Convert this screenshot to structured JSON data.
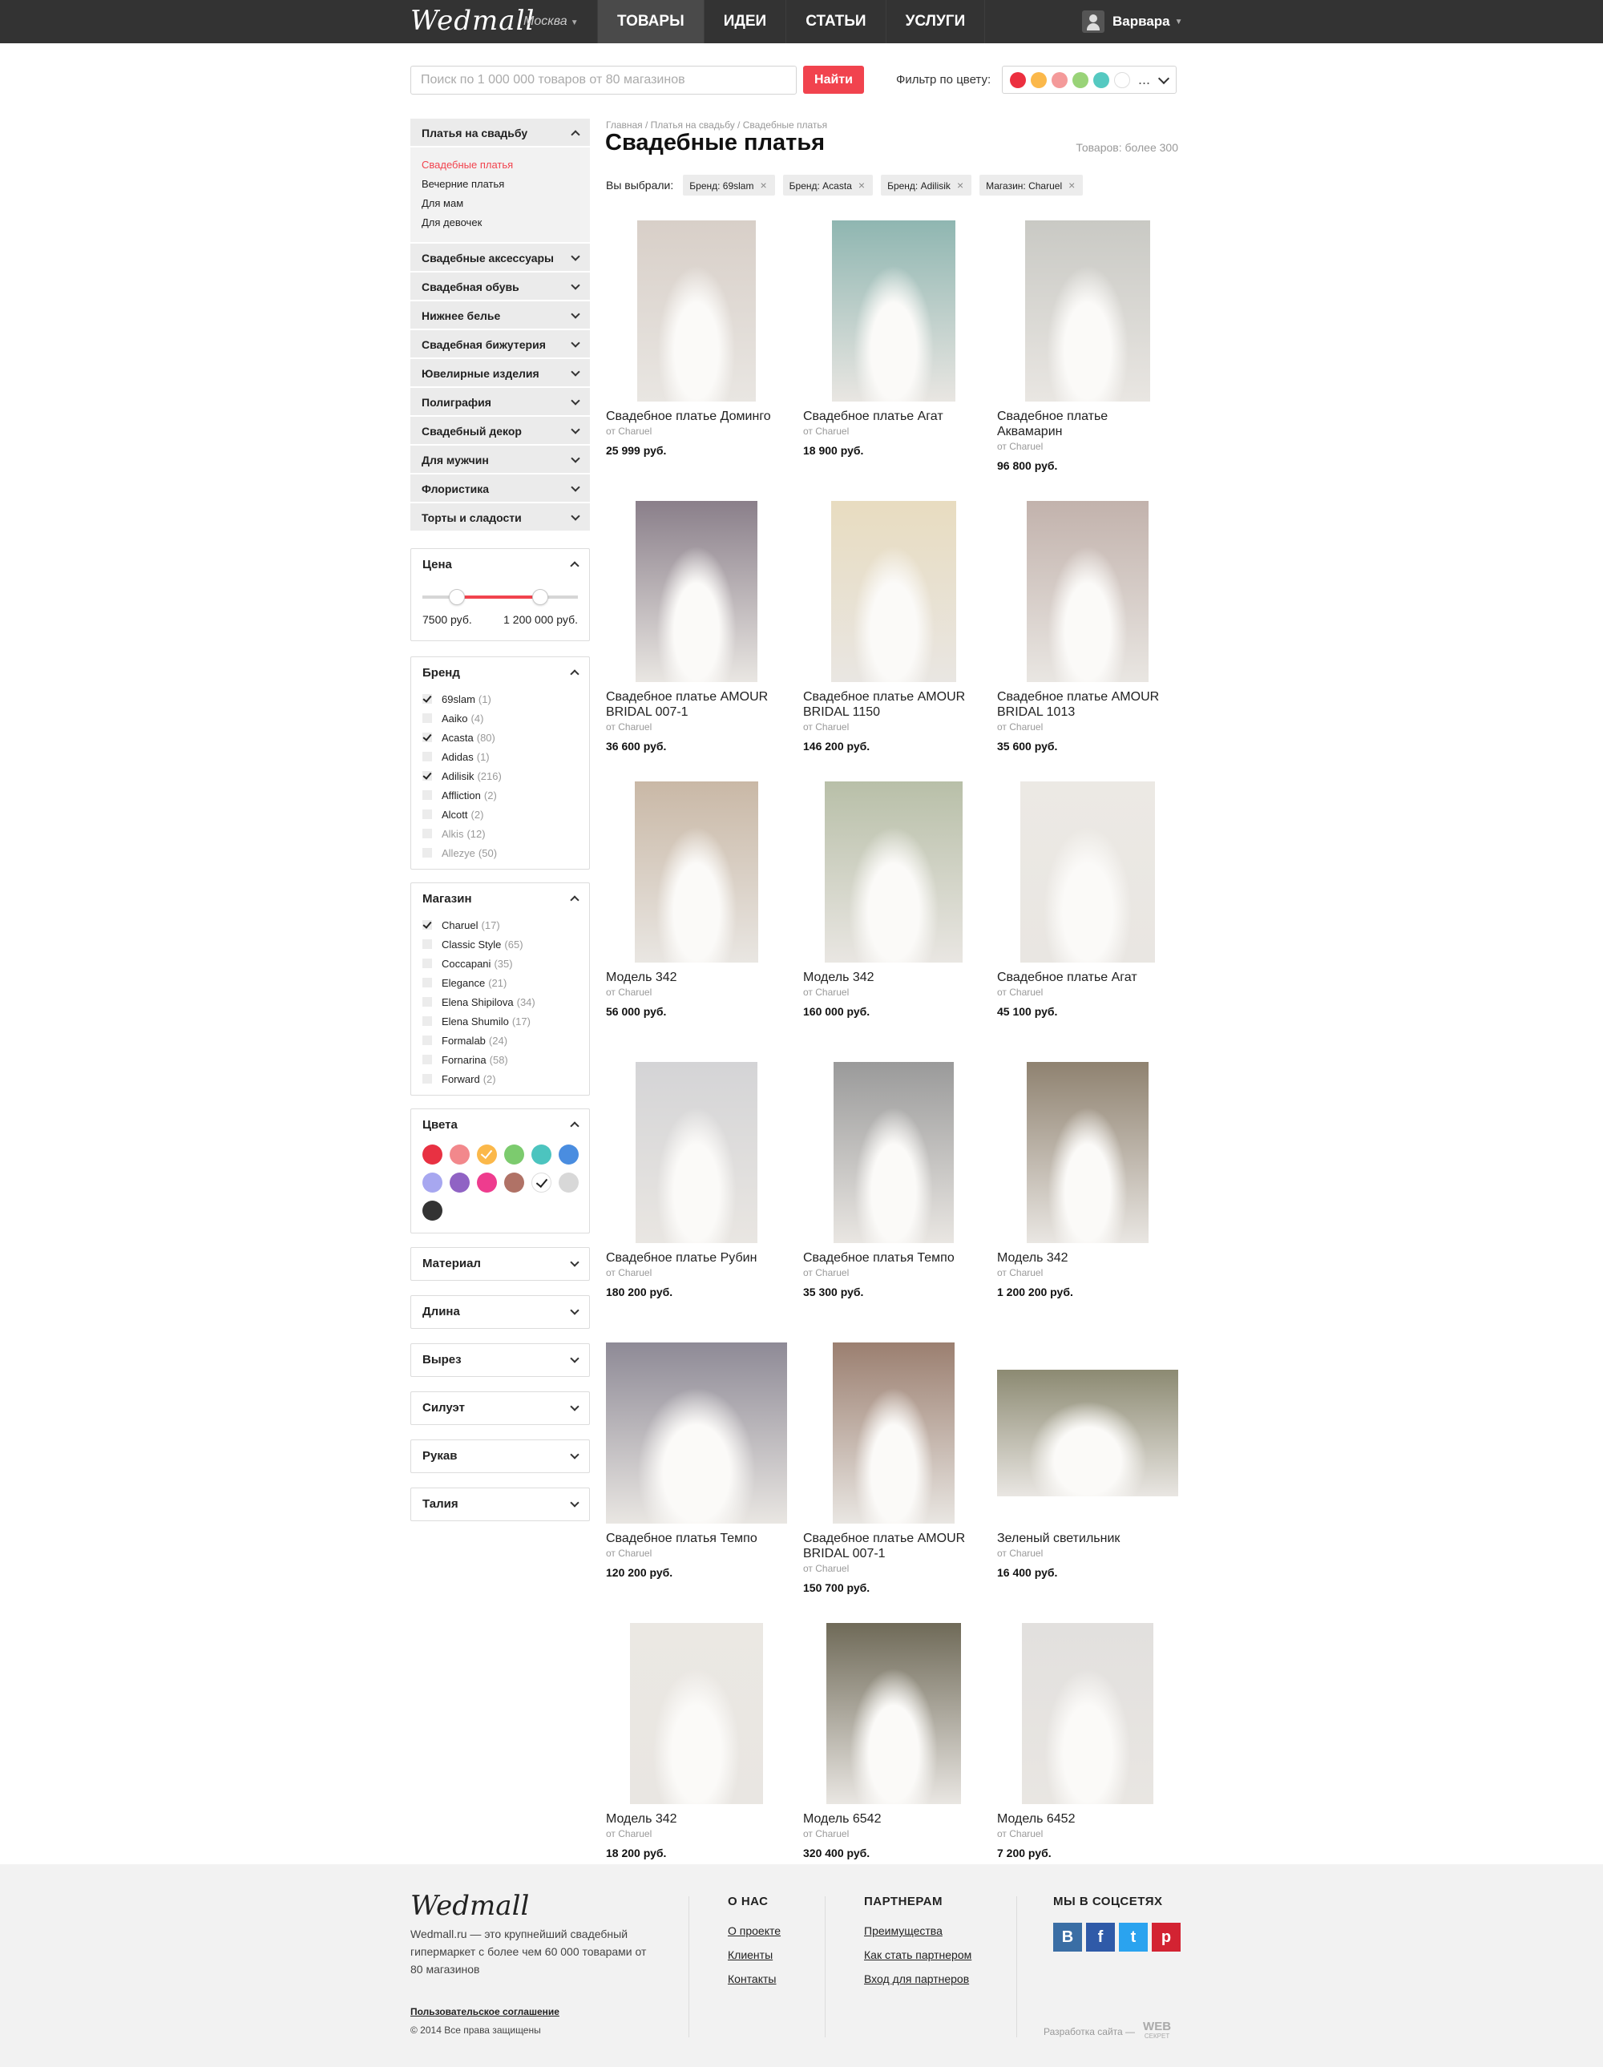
{
  "header": {
    "logo": "Wedmall",
    "city": "Москва",
    "nav": [
      "ТОВАРЫ",
      "ИДЕИ",
      "СТАТЬИ",
      "УСЛУГИ"
    ],
    "user": "Варвара"
  },
  "search": {
    "placeholder": "Поиск по 1 000 000 товаров от 80 магазинов",
    "button": "Найти",
    "color_filter_label": "Фильтр по цвету:",
    "color_filter_dots": [
      "#ec2f3f",
      "#fbb84a",
      "#f49a9a",
      "#99d378",
      "#55c9c1",
      "#ffffff"
    ],
    "more": "..."
  },
  "sidebar": {
    "open_category": "Платья на свадьбу",
    "subcategories": [
      "Свадебные платья",
      "Вечерние платья",
      "Для мам",
      "Для девочек"
    ],
    "categories": [
      "Свадебные аксессуары",
      "Свадебная обувь",
      "Нижнее белье",
      "Свадебная бижутерия",
      "Ювелирные изделия",
      "Полиграфия",
      "Свадебный декор",
      "Для мужчин",
      "Флористика",
      "Торты и сладости"
    ],
    "price": {
      "title": "Цена",
      "min": "7500 руб.",
      "max": "1 200 000 руб.",
      "range_low": 0.22,
      "range_high": 0.75
    },
    "brand": {
      "title": "Бренд",
      "items": [
        {
          "name": "69slam",
          "count": "(1)",
          "checked": true
        },
        {
          "name": "Aaiko",
          "count": "(4)",
          "checked": false
        },
        {
          "name": "Acasta",
          "count": "(80)",
          "checked": true
        },
        {
          "name": "Adidas",
          "count": "(1)",
          "checked": false
        },
        {
          "name": "Adilisik",
          "count": "(216)",
          "checked": true
        },
        {
          "name": "Affliction",
          "count": "(2)",
          "checked": false
        },
        {
          "name": "Alcott",
          "count": "(2)",
          "checked": false
        },
        {
          "name": "Alkis",
          "count": "(12)",
          "checked": false
        },
        {
          "name": "Allezye",
          "count": "(50)",
          "checked": false
        }
      ]
    },
    "shop": {
      "title": "Магазин",
      "items": [
        {
          "name": "Charuel",
          "count": "(17)",
          "checked": true
        },
        {
          "name": "Classic Style",
          "count": "(65)",
          "checked": false
        },
        {
          "name": "Coccapani",
          "count": "(35)",
          "checked": false
        },
        {
          "name": "Elegance",
          "count": "(21)",
          "checked": false
        },
        {
          "name": "Elena Shipilova",
          "count": "(34)",
          "checked": false
        },
        {
          "name": "Elena Shumilo",
          "count": "(17)",
          "checked": false
        },
        {
          "name": "Formalab",
          "count": "(24)",
          "checked": false
        },
        {
          "name": "Fornarina",
          "count": "(58)",
          "checked": false
        },
        {
          "name": "Forward",
          "count": "(2)",
          "checked": false
        }
      ]
    },
    "colors": {
      "title": "Цвета",
      "swatches": [
        {
          "color": "#e83142",
          "checked": false
        },
        {
          "color": "#f2888c",
          "checked": false
        },
        {
          "color": "#fbb84a",
          "checked": true
        },
        {
          "color": "#7ccb6e",
          "checked": false
        },
        {
          "color": "#4cc4bf",
          "checked": false
        },
        {
          "color": "#4a8de0",
          "checked": false
        },
        {
          "color": "#a7a7f0",
          "checked": false
        },
        {
          "color": "#9063c4",
          "checked": false
        },
        {
          "color": "#ee3c8e",
          "checked": false
        },
        {
          "color": "#b07266",
          "checked": false
        },
        {
          "color": "#ffffff",
          "checked": true
        },
        {
          "color": "#d8d8d8",
          "checked": false
        },
        {
          "color": "#333333",
          "checked": false
        }
      ]
    },
    "collapsed_filters": [
      "Материал",
      "Длина",
      "Вырез",
      "Силуэт",
      "Рукав",
      "Талия"
    ]
  },
  "main": {
    "breadcrumb": "Главная / Платья на свадьбу / Свадебные платья",
    "title": "Свадебные платья",
    "count": "Товаров: более 300",
    "chosen_label": "Вы выбрали:",
    "tags": [
      "Бренд: 69slam",
      "Бренд: Acasta",
      "Бренд: Adilisik",
      "Магазин: Charuel"
    ],
    "products": [
      {
        "name": "Свадебное платье Доминго",
        "by": "от Charuel",
        "price": "25 999 руб.",
        "tone": "#d8cfc8"
      },
      {
        "name": "Свадебное платье Агат",
        "by": "от Charuel",
        "price": "18 900 руб.",
        "tone": "#8fb6b1"
      },
      {
        "name": "Свадебное платье Аквамарин",
        "by": "от Charuel",
        "price": "96 800 руб.",
        "tone": "#c9c9c4"
      },
      {
        "name": "Свадебное платье AMOUR BRIDAL 007-1",
        "by": "от Charuel",
        "price": "36 600 руб.",
        "tone": "#8a7f8a"
      },
      {
        "name": "Свадебное платье AMOUR BRIDAL 1150",
        "by": "от Charuel",
        "price": "146 200 руб.",
        "tone": "#e8dcc0"
      },
      {
        "name": "Свадебное платье AMOUR BRIDAL 1013",
        "by": "от Charuel",
        "price": "35 600 руб.",
        "tone": "#c2b2ac"
      },
      {
        "name": "Модель 342",
        "by": "от Charuel",
        "price": "56 000 руб.",
        "tone": "#c9b8a6"
      },
      {
        "name": "Модель 342",
        "by": "от Charuel",
        "price": "160 000 руб.",
        "tone": "#b8bfa8"
      },
      {
        "name": "Свадебное платье Агат",
        "by": "от Charuel",
        "price": "45 100 руб.",
        "tone": "#ece9e4"
      },
      {
        "name": "Свадебное платье Рубин",
        "by": "от Charuel",
        "price": "180 200 руб.",
        "tone": "#d4d4d6"
      },
      {
        "name": "Свадебное платья Темпо",
        "by": "от Charuel",
        "price": "35 300 руб.",
        "tone": "#9a9a9a"
      },
      {
        "name": "Модель 342",
        "by": "от Charuel",
        "price": "1 200 200 руб.",
        "tone": "#8f8270"
      },
      {
        "name": "Свадебное платья Темпо",
        "by": "от Charuel",
        "price": "120 200 руб.",
        "tone": "#8e8a96"
      },
      {
        "name": "Свадебное платье AMOUR BRIDAL 007-1",
        "by": "от Charuel",
        "price": "150 700 руб.",
        "tone": "#9b7f70"
      },
      {
        "name": "Зеленый светильник",
        "by": "от Charuel",
        "price": "16 400 руб.",
        "tone": "#8c8a72"
      },
      {
        "name": "Модель 342",
        "by": "от Charuel",
        "price": "18 200 руб.",
        "tone": "#ebe8e3"
      },
      {
        "name": "Модель 6542",
        "by": "от Charuel",
        "price": "320 400 руб.",
        "tone": "#6f6a58"
      },
      {
        "name": "Модель 6452",
        "by": "от Charuel",
        "price": "7 200 руб.",
        "tone": "#e2e0de"
      }
    ]
  },
  "footer": {
    "logo": "Wedmall",
    "description": "Wedmall.ru — это крупнейший свадебный гипермаркет с более чем 60 000 товарами от 80 магазинов",
    "terms": "Пользовательское соглашение",
    "copyright": "© 2014 Все права защищены",
    "about": {
      "title": "О НАС",
      "links": [
        "О проекте",
        "Клиенты",
        "Контакты"
      ]
    },
    "partners": {
      "title": "ПАРТНЕРАМ",
      "links": [
        "Преимущества",
        "Как стать партнером",
        "Вход для партнеров"
      ]
    },
    "social": {
      "title": "МЫ В СОЦСЕТЯХ",
      "icons": [
        {
          "label": "B",
          "color": "#3a6ea5",
          "name": "vk-icon"
        },
        {
          "label": "f",
          "color": "#2f5aa8",
          "name": "facebook-icon"
        },
        {
          "label": "t",
          "color": "#2aa3ef",
          "name": "twitter-icon"
        },
        {
          "label": "p",
          "color": "#d32332",
          "name": "pinterest-icon"
        }
      ]
    },
    "credit": "Разработка сайта —",
    "credit_logo": "WEB",
    "credit_logo_sub": "СЕКРЕТ"
  }
}
